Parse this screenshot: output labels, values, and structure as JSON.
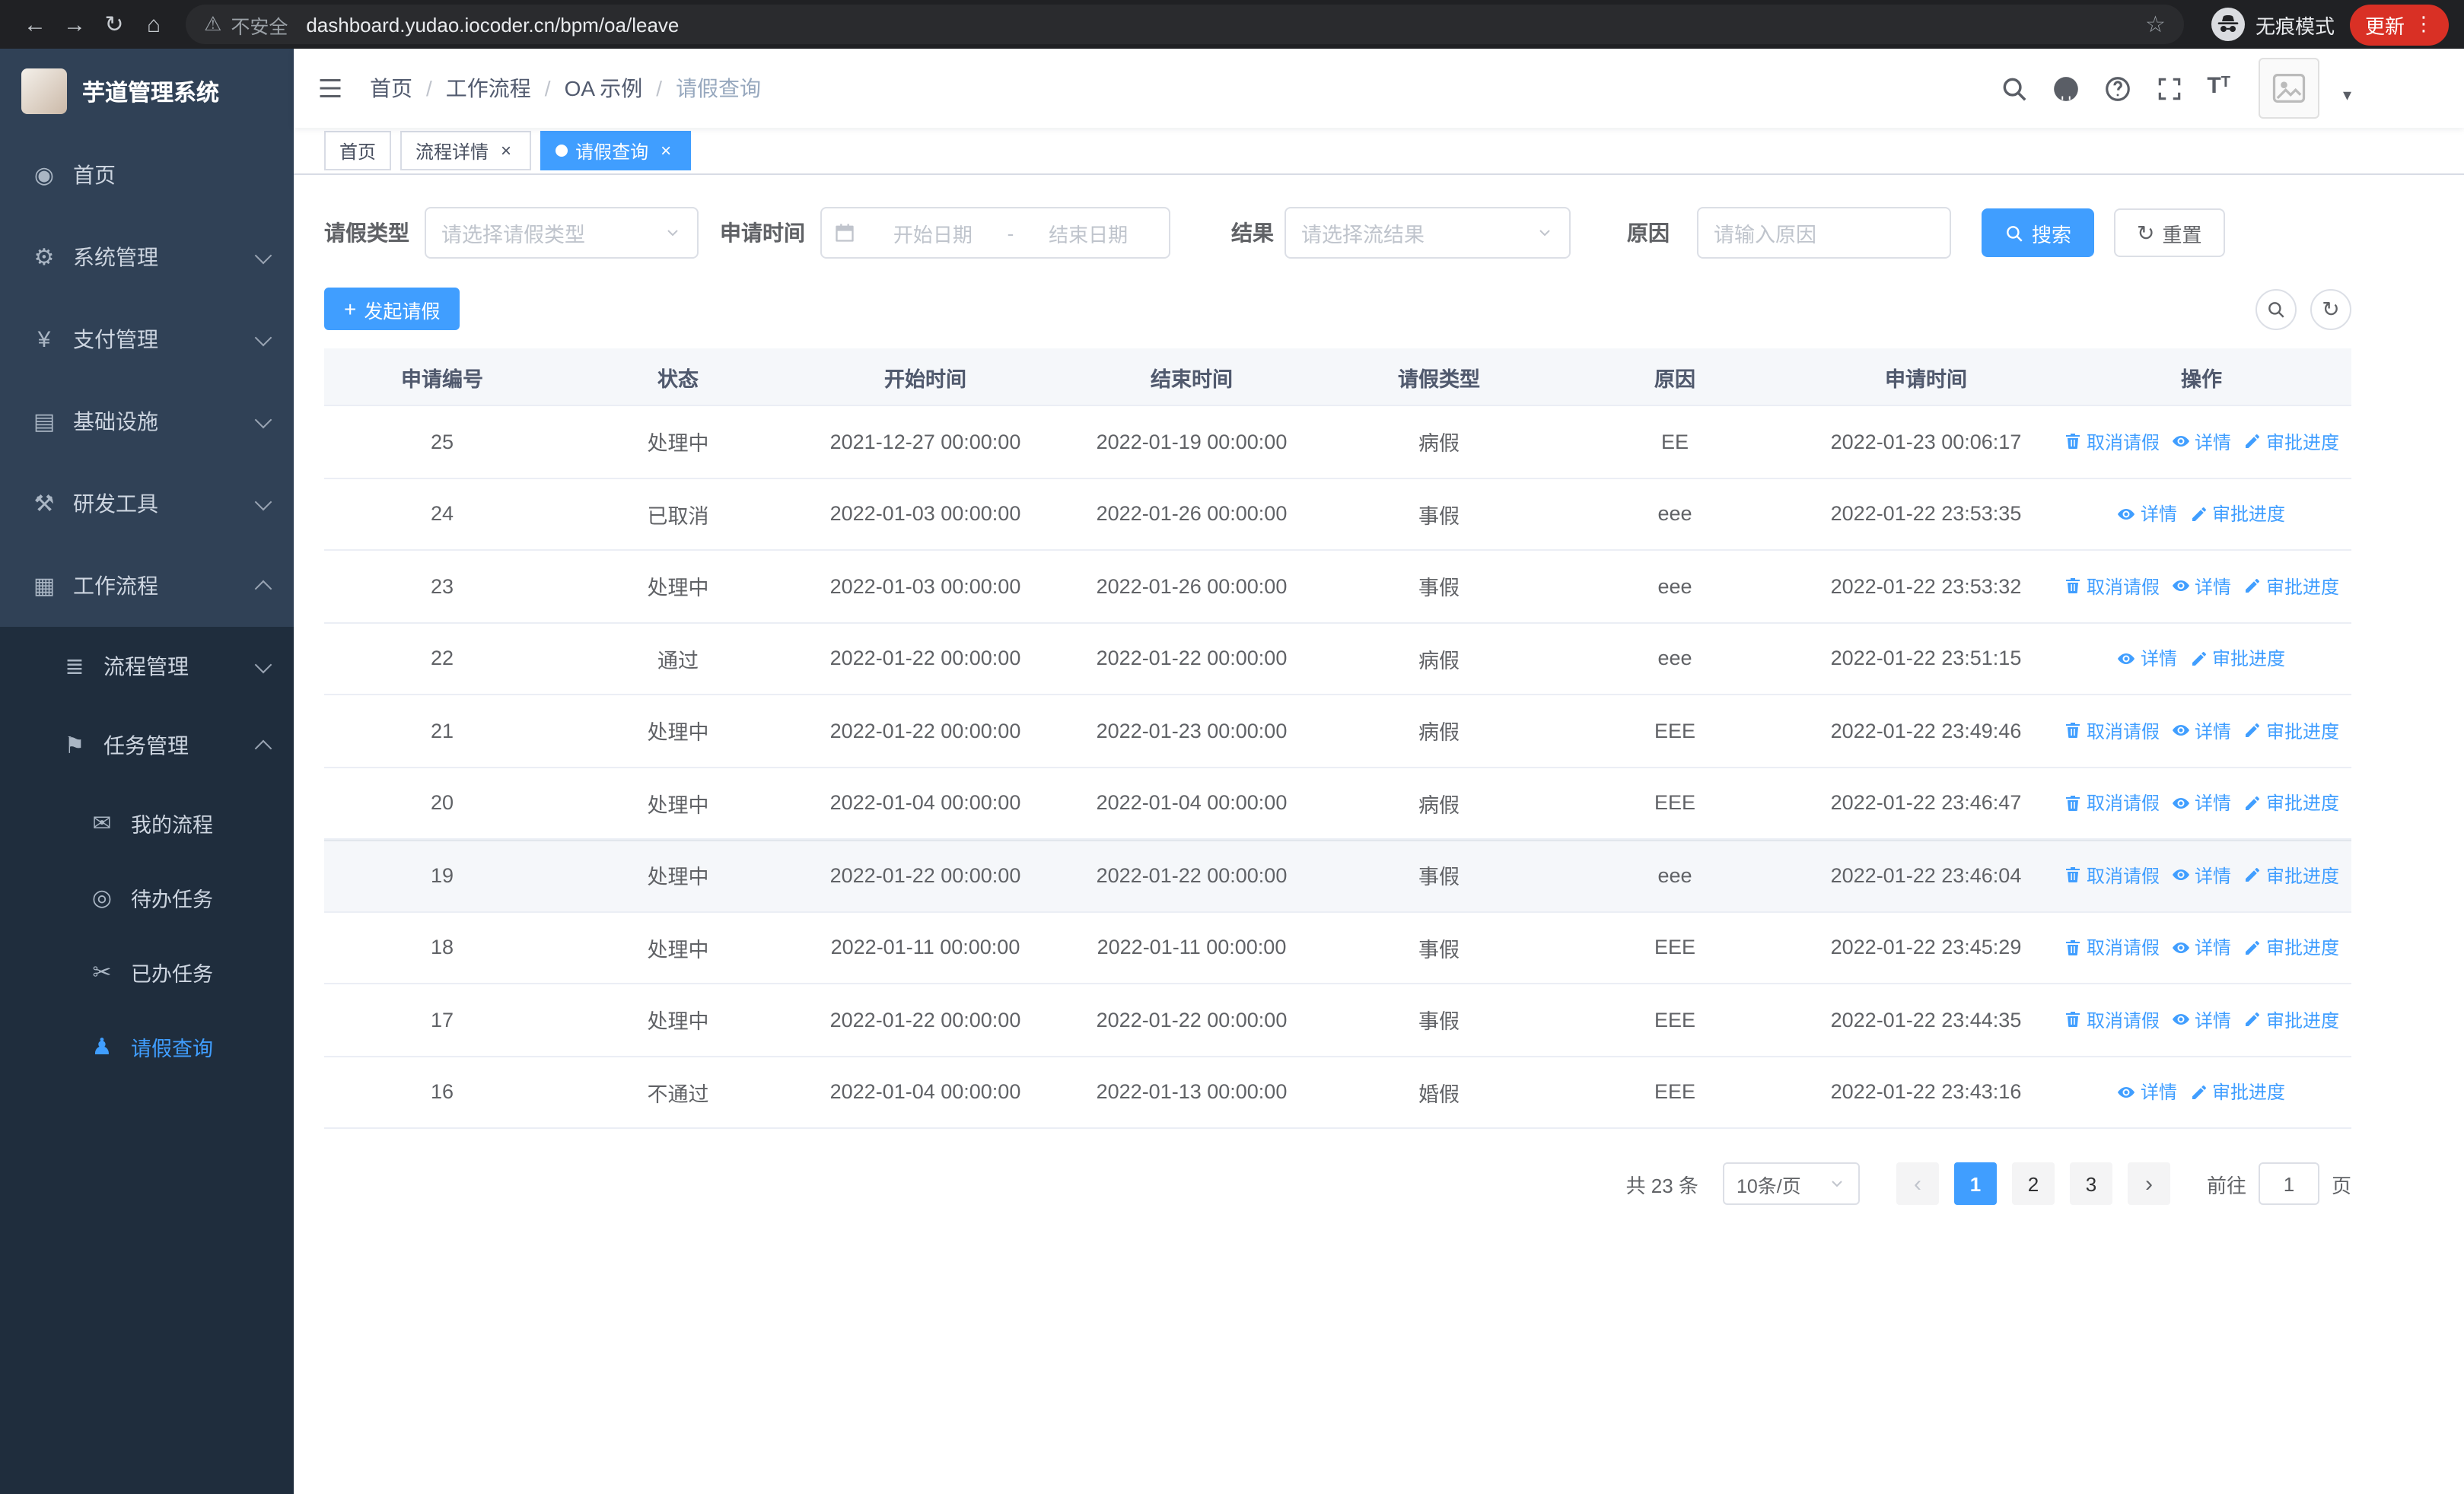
{
  "browser": {
    "security_label": "不安全",
    "url": "dashboard.yudao.iocoder.cn/bpm/oa/leave",
    "incognito_label": "无痕模式",
    "update_label": "更新"
  },
  "sidebar": {
    "app_title": "芋道管理系统",
    "items": [
      {
        "key": "home",
        "label": "首页",
        "icon": "dashboard-icon",
        "depth": 1
      },
      {
        "key": "system",
        "label": "系统管理",
        "icon": "gear-icon",
        "depth": 1,
        "arrow": "down"
      },
      {
        "key": "payment",
        "label": "支付管理",
        "icon": "yen-icon",
        "depth": 1,
        "arrow": "down"
      },
      {
        "key": "infra",
        "label": "基础设施",
        "icon": "monitor-icon",
        "depth": 1,
        "arrow": "down"
      },
      {
        "key": "devtools",
        "label": "研发工具",
        "icon": "wrench-icon",
        "depth": 1,
        "arrow": "down"
      },
      {
        "key": "workflow",
        "label": "工作流程",
        "icon": "briefcase-icon",
        "depth": 1,
        "arrow": "up"
      },
      {
        "key": "process-mgmt",
        "label": "流程管理",
        "icon": "list-icon",
        "depth": 2,
        "arrow": "down"
      },
      {
        "key": "task-mgmt",
        "label": "任务管理",
        "icon": "flag-icon",
        "depth": 2,
        "arrow": "up"
      },
      {
        "key": "my-process",
        "label": "我的流程",
        "icon": "chat-icon",
        "depth": 3
      },
      {
        "key": "todo-tasks",
        "label": "待办任务",
        "icon": "eye-icon",
        "depth": 3
      },
      {
        "key": "done-tasks",
        "label": "已办任务",
        "icon": "scissors-icon",
        "depth": 3
      },
      {
        "key": "leave-query",
        "label": "请假查询",
        "icon": "user-icon",
        "depth": 3,
        "active": true
      }
    ]
  },
  "header": {
    "breadcrumb": [
      "首页",
      "工作流程",
      "OA 示例",
      "请假查询"
    ]
  },
  "tabs": [
    {
      "label": "首页",
      "active": false,
      "closable": false
    },
    {
      "label": "流程详情",
      "active": false,
      "closable": true
    },
    {
      "label": "请假查询",
      "active": true,
      "closable": true
    }
  ],
  "filters": {
    "leave_type_label": "请假类型",
    "leave_type_placeholder": "请选择请假类型",
    "apply_time_label": "申请时间",
    "start_date_placeholder": "开始日期",
    "range_separator": "-",
    "end_date_placeholder": "结束日期",
    "result_label": "结果",
    "result_placeholder": "请选择流结果",
    "reason_label": "原因",
    "reason_placeholder": "请输入原因",
    "search_label": "搜索",
    "reset_label": "重置"
  },
  "toolbar": {
    "create_label": "发起请假"
  },
  "table": {
    "columns": [
      "申请编号",
      "状态",
      "开始时间",
      "结束时间",
      "请假类型",
      "原因",
      "申请时间",
      "操作"
    ],
    "action_labels": {
      "cancel": "取消请假",
      "detail": "详情",
      "progress": "审批进度"
    },
    "rows": [
      {
        "id": "25",
        "status": "处理中",
        "start": "2021-12-27 00:00:00",
        "end": "2022-01-19 00:00:00",
        "type": "病假",
        "reason": "EE",
        "applied": "2022-01-23 00:06:17",
        "actions": [
          "cancel",
          "detail",
          "progress"
        ],
        "highlight": false
      },
      {
        "id": "24",
        "status": "已取消",
        "start": "2022-01-03 00:00:00",
        "end": "2022-01-26 00:00:00",
        "type": "事假",
        "reason": "eee",
        "applied": "2022-01-22 23:53:35",
        "actions": [
          "detail",
          "progress"
        ],
        "highlight": false
      },
      {
        "id": "23",
        "status": "处理中",
        "start": "2022-01-03 00:00:00",
        "end": "2022-01-26 00:00:00",
        "type": "事假",
        "reason": "eee",
        "applied": "2022-01-22 23:53:32",
        "actions": [
          "cancel",
          "detail",
          "progress"
        ],
        "highlight": false
      },
      {
        "id": "22",
        "status": "通过",
        "start": "2022-01-22 00:00:00",
        "end": "2022-01-22 00:00:00",
        "type": "病假",
        "reason": "eee",
        "applied": "2022-01-22 23:51:15",
        "actions": [
          "detail",
          "progress"
        ],
        "highlight": false
      },
      {
        "id": "21",
        "status": "处理中",
        "start": "2022-01-22 00:00:00",
        "end": "2022-01-23 00:00:00",
        "type": "病假",
        "reason": "EEE",
        "applied": "2022-01-22 23:49:46",
        "actions": [
          "cancel",
          "detail",
          "progress"
        ],
        "highlight": false
      },
      {
        "id": "20",
        "status": "处理中",
        "start": "2022-01-04 00:00:00",
        "end": "2022-01-04 00:00:00",
        "type": "病假",
        "reason": "EEE",
        "applied": "2022-01-22 23:46:47",
        "actions": [
          "cancel",
          "detail",
          "progress"
        ],
        "highlight": false
      },
      {
        "id": "19",
        "status": "处理中",
        "start": "2022-01-22 00:00:00",
        "end": "2022-01-22 00:00:00",
        "type": "事假",
        "reason": "eee",
        "applied": "2022-01-22 23:46:04",
        "actions": [
          "cancel",
          "detail",
          "progress"
        ],
        "highlight": true
      },
      {
        "id": "18",
        "status": "处理中",
        "start": "2022-01-11 00:00:00",
        "end": "2022-01-11 00:00:00",
        "type": "事假",
        "reason": "EEE",
        "applied": "2022-01-22 23:45:29",
        "actions": [
          "cancel",
          "detail",
          "progress"
        ],
        "highlight": false
      },
      {
        "id": "17",
        "status": "处理中",
        "start": "2022-01-22 00:00:00",
        "end": "2022-01-22 00:00:00",
        "type": "事假",
        "reason": "EEE",
        "applied": "2022-01-22 23:44:35",
        "actions": [
          "cancel",
          "detail",
          "progress"
        ],
        "highlight": false
      },
      {
        "id": "16",
        "status": "不通过",
        "start": "2022-01-04 00:00:00",
        "end": "2022-01-13 00:00:00",
        "type": "婚假",
        "reason": "EEE",
        "applied": "2022-01-22 23:43:16",
        "actions": [
          "detail",
          "progress"
        ],
        "highlight": false
      }
    ]
  },
  "pagination": {
    "total_label": "共 23 条",
    "page_size_label": "10条/页",
    "pages": [
      "1",
      "2",
      "3"
    ],
    "active_page": "1",
    "goto_label": "前往",
    "goto_value": "1",
    "goto_suffix": "页"
  },
  "colors": {
    "accent": "#409EFF",
    "sidebar_bg": "#304156",
    "submenu_bg": "#1f2d3d",
    "chrome_bg": "#202124",
    "update_red": "#d93025"
  }
}
